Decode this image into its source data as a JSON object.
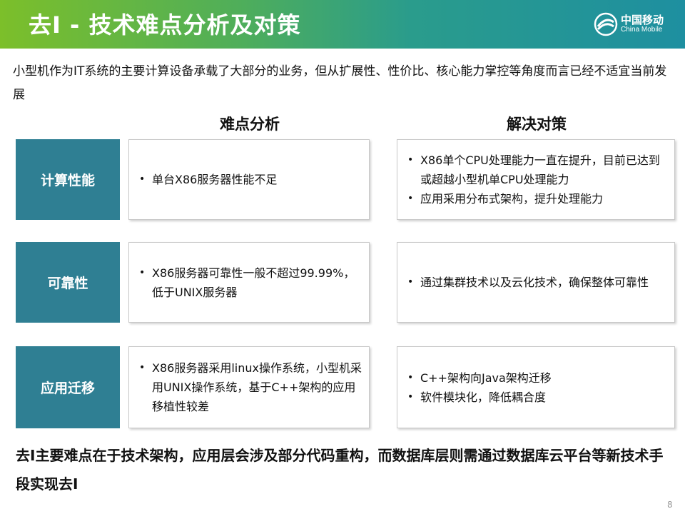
{
  "header": {
    "title": "去I - 技术难点分析及对策",
    "logo": {
      "cn": "中国移动",
      "en": "China Mobile"
    }
  },
  "intro": "小型机作为IT系统的主要计算设备承载了大部分的业务，但从扩展性、性价比、核心能力掌控等角度而言已经不适宜当前发展",
  "columns": {
    "analysis": "难点分析",
    "solution": "解决对策"
  },
  "rows": [
    {
      "label": "计算性能",
      "analysis": [
        "单台X86服务器性能不足"
      ],
      "solution": [
        "X86单个CPU处理能力一直在提升，目前已达到或超越小型机单CPU处理能力",
        "应用采用分布式架构，提升处理能力"
      ]
    },
    {
      "label": "可靠性",
      "analysis": [
        "X86服务器可靠性一般不超过99.99%，低于UNIX服务器"
      ],
      "solution": [
        "通过集群技术以及云化技术，确保整体可靠性"
      ]
    },
    {
      "label": "应用迁移",
      "analysis": [
        "X86服务器采用linux操作系统，小型机采用UNIX操作系统，基于C++架构的应用移植性较差"
      ],
      "solution": [
        "C++架构向Java架构迁移",
        "软件模块化，降低耦合度"
      ]
    }
  ],
  "conclusion": "去I主要难点在于技术架构，应用层会涉及部分代码重构，而数据库层则需通过数据库云平台等新技术手段实现去I",
  "page_number": "8",
  "colors": {
    "label_bg": "#2f7f93",
    "header_start": "#7cbf2a",
    "header_end": "#1e8fa0"
  }
}
